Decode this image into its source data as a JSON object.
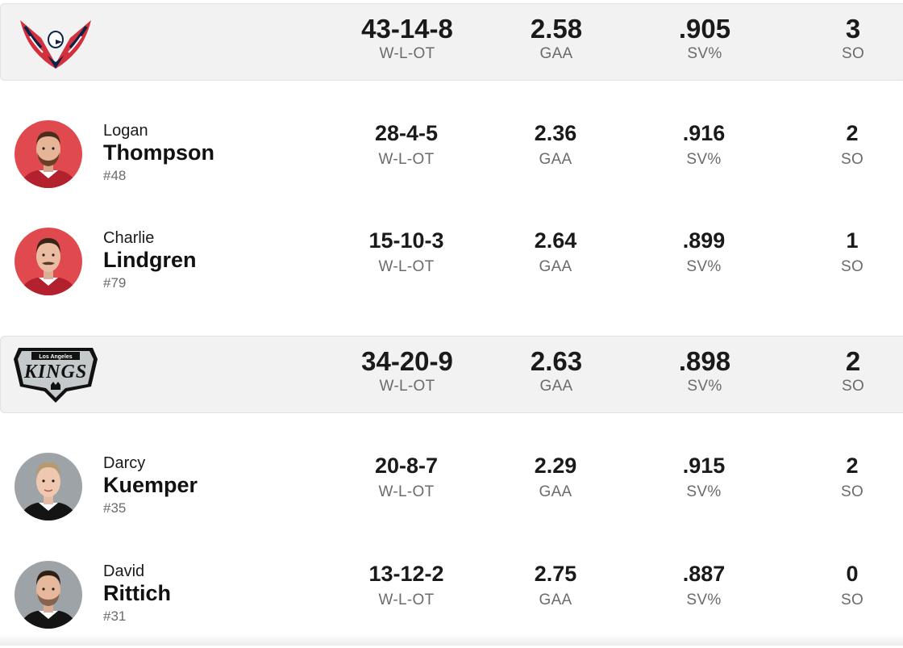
{
  "teams": [
    {
      "logo_icon": "capitals-eagle-logo-icon",
      "record": "43-14-8",
      "record_label": "W-L-OT",
      "gaa": "2.58",
      "gaa_label": "GAA",
      "svpct": ".905",
      "svpct_label": "SV%",
      "so": "3",
      "so_label": "SO",
      "players": [
        {
          "first": "Logan",
          "last": "Thompson",
          "number": "#48",
          "record": "28-4-5",
          "record_label": "W-L-OT",
          "gaa": "2.36",
          "gaa_label": "GAA",
          "svpct": ".916",
          "svpct_label": "SV%",
          "so": "2",
          "so_label": "SO"
        },
        {
          "first": "Charlie",
          "last": "Lindgren",
          "number": "#79",
          "record": "15-10-3",
          "record_label": "W-L-OT",
          "gaa": "2.64",
          "gaa_label": "GAA",
          "svpct": ".899",
          "svpct_label": "SV%",
          "so": "1",
          "so_label": "SO"
        }
      ]
    },
    {
      "logo_icon": "kings-shield-logo-icon",
      "logo_text_small": "Los Angeles",
      "logo_text": "KINGS",
      "record": "34-20-9",
      "record_label": "W-L-OT",
      "gaa": "2.63",
      "gaa_label": "GAA",
      "svpct": ".898",
      "svpct_label": "SV%",
      "so": "2",
      "so_label": "SO",
      "players": [
        {
          "first": "Darcy",
          "last": "Kuemper",
          "number": "#35",
          "record": "20-8-7",
          "record_label": "W-L-OT",
          "gaa": "2.29",
          "gaa_label": "GAA",
          "svpct": ".915",
          "svpct_label": "SV%",
          "so": "2",
          "so_label": "SO"
        },
        {
          "first": "David",
          "last": "Rittich",
          "number": "#31",
          "record": "13-12-2",
          "record_label": "W-L-OT",
          "gaa": "2.75",
          "gaa_label": "GAA",
          "svpct": ".887",
          "svpct_label": "SV%",
          "so": "0",
          "so_label": "SO"
        }
      ]
    }
  ],
  "colors": {
    "capitals_red": "#d32f3c",
    "capitals_navy": "#0b2247",
    "kings_black": "#111111",
    "kings_silver": "#a2aaad",
    "avatar_red_bg": "#e04a4f",
    "avatar_gray_bg": "#9ea3a7",
    "bar_bg": "#f2f2f2",
    "label_gray": "#6b6b6b"
  }
}
